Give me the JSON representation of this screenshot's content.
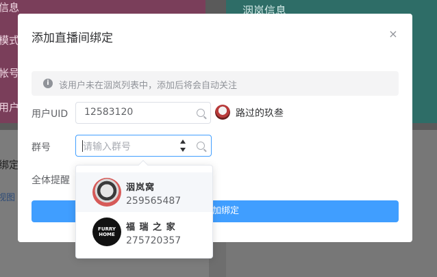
{
  "background": {
    "left_card_labels": [
      "信息",
      "模式",
      "帐号",
      "用户"
    ],
    "right_card_title": "洇岚信息",
    "lower_left_title": "绑定",
    "lower_left_tab": "视图"
  },
  "dialog": {
    "title": "添加直播间绑定",
    "close_icon": "×",
    "notice": {
      "icon": "i",
      "text": "该用户未在洇岚列表中，添加后将会自动关注"
    },
    "uid": {
      "label": "用户UID",
      "value": "12583120",
      "resolved_user_name": "路过的玖叁"
    },
    "group": {
      "label": "群号",
      "placeholder": "请输入群号",
      "options": [
        {
          "name": "洇岚窝",
          "id": "259565487"
        },
        {
          "name": "福 瑞 之 家",
          "id": "275720357"
        }
      ]
    },
    "mention_all": {
      "label": "全体提醒"
    },
    "submit_label": "添加绑定",
    "submit_visible_fragment": "加绑定"
  },
  "colors": {
    "primary": "#409eff",
    "overlay": "#5a5a5a",
    "text_primary": "#303133",
    "text_regular": "#606266",
    "text_placeholder": "#a8abb2"
  },
  "avatar_text": {
    "furry_home_logo": "FURRY\nHOME"
  }
}
